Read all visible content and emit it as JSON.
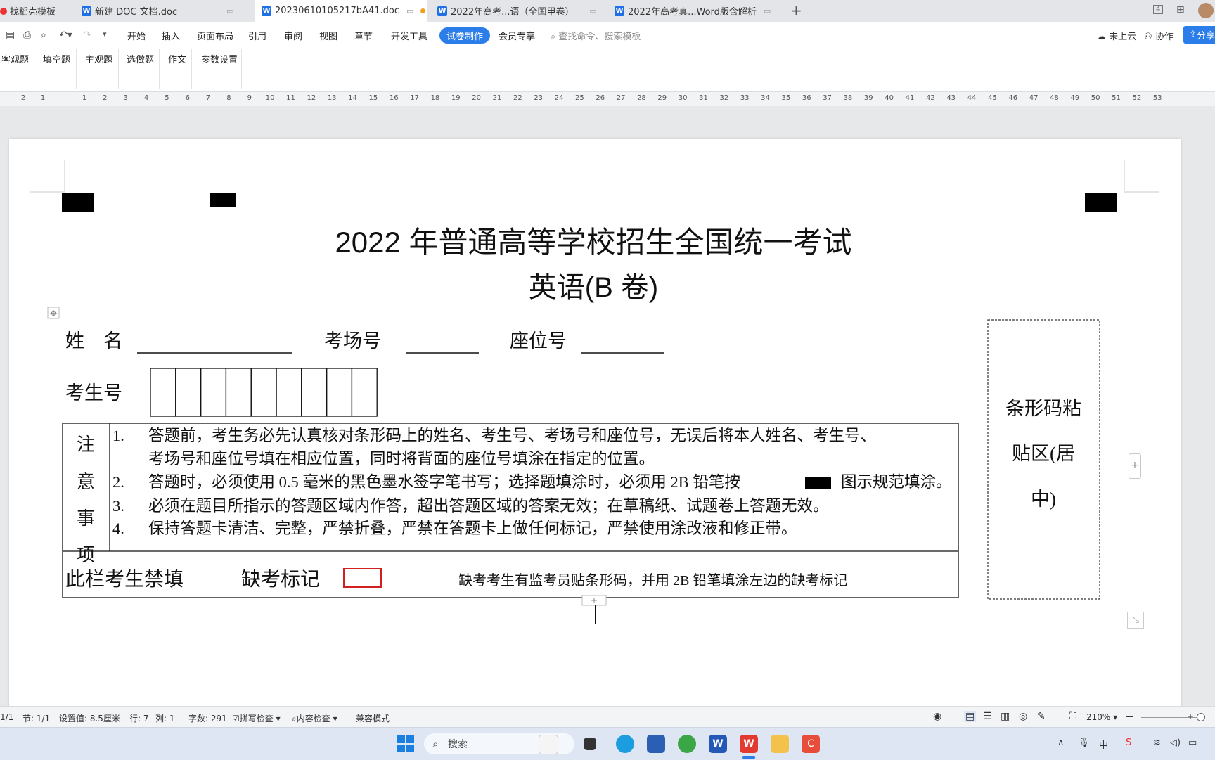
{
  "tabs": [
    {
      "label": "找稻壳模板",
      "icon": "wps-red-icon"
    },
    {
      "label": "新建 DOC 文档.doc",
      "icon": "word-doc-icon"
    },
    {
      "label": "20230610105217bA41.doc",
      "icon": "word-doc-icon",
      "active": true
    },
    {
      "label": "2022年高考...语（全国甲卷）",
      "icon": "word-doc-icon"
    },
    {
      "label": "2022年高考真...Word版含解析",
      "icon": "word-doc-icon"
    }
  ],
  "window": {
    "tab_count": "4"
  },
  "menu": [
    "开始",
    "插入",
    "页面布局",
    "引用",
    "审阅",
    "视图",
    "章节",
    "开发工具",
    "试卷制作",
    "会员专享"
  ],
  "menu_active": "试卷制作",
  "search_placeholder": "查找命令、搜索模板",
  "cloud_label": "未上云",
  "collab_label": "协作",
  "share_label": "分享",
  "subtoolbar": [
    "客观题",
    "填空题",
    "主观题",
    "选做题",
    "作文",
    "参数设置"
  ],
  "ruler_numbers": [
    "2",
    "1",
    "1",
    "2",
    "3",
    "4",
    "5",
    "6",
    "7",
    "8",
    "9",
    "10",
    "11",
    "12",
    "13",
    "14",
    "15",
    "16",
    "17",
    "18",
    "19",
    "20",
    "21",
    "22",
    "23",
    "24",
    "25",
    "26",
    "27",
    "28",
    "29",
    "30",
    "31",
    "32",
    "33",
    "34",
    "35",
    "36",
    "37",
    "38",
    "39",
    "40",
    "41",
    "42",
    "43",
    "44",
    "45",
    "46",
    "47",
    "48",
    "49",
    "50",
    "51",
    "52",
    "53"
  ],
  "document": {
    "title": "2022 年普通高等学校招生全国统一考试",
    "subtitle": "英语(B 卷)",
    "name_label": "姓　名",
    "room_label": "考场号",
    "seat_label": "座位号",
    "student_no_label": "考生号",
    "notice_label": [
      "注",
      "意",
      "事",
      "项"
    ],
    "instructions": [
      {
        "num": "1.",
        "text": "答题前，考生务必先认真核对条形码上的姓名、考生号、考场号和座位号，无误后将本人姓名、考生号、考场号和座位号填在相应位置，同时将背面的座位号填涂在指定的位置。"
      },
      {
        "num": "2.",
        "text_before": "答题时，必须使用 0.5 毫米的黑色墨水签字笔书写；选择题填涂时，必须用 2B 铅笔按",
        "text_after": "图示规范填涂。"
      },
      {
        "num": "3.",
        "text": "必须在题目所指示的答题区域内作答，超出答题区域的答案无效；在草稿纸、试题卷上答题无效。"
      },
      {
        "num": "4.",
        "text": "保持答题卡清洁、完整，严禁折叠，严禁在答题卡上做任何标记，严禁使用涂改液和修正带。"
      }
    ],
    "forbidden_label": "此栏考生禁填",
    "absent_label": "缺考标记",
    "absent_note": "缺考考生有监考员贴条形码，并用 2B 铅笔填涂左边的缺考标记",
    "barcode_label": [
      "条形码粘",
      "贴区(居",
      "中)"
    ]
  },
  "status": {
    "page": "1/1",
    "section": "节: 1/1",
    "setting": "设置值: 8.5厘米",
    "row": "行: 7",
    "col": "列: 1",
    "words": "字数: 291",
    "spell": "拼写检查",
    "content_check": "内容检查",
    "compat": "兼容模式",
    "zoom": "210%"
  },
  "taskbar": {
    "search": "搜索"
  }
}
